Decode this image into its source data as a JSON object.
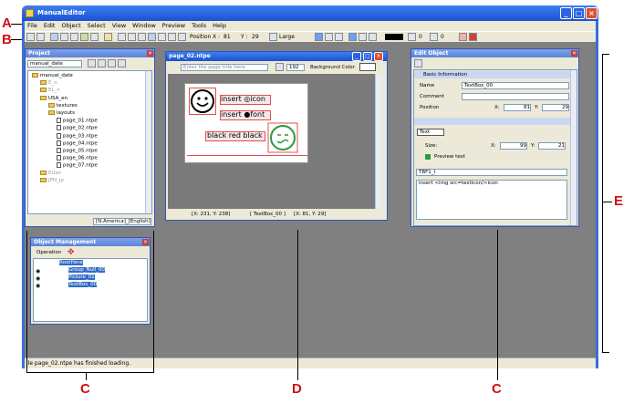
{
  "callouts": {
    "a": "A",
    "b": "B",
    "c": "C",
    "d": "D",
    "e": "E"
  },
  "app": {
    "title": "ManualEditor"
  },
  "menu": [
    "File",
    "Edit",
    "Object",
    "Select",
    "View",
    "Window",
    "Preview",
    "Tools",
    "Help"
  ],
  "toolbar": {
    "position_label": "Position",
    "x_label": "X :",
    "x_value": "81",
    "y_label": "Y :",
    "y_value": "29",
    "font_size": "Large",
    "spacing_a": "0",
    "spacing_b": "0"
  },
  "project": {
    "title": "Project",
    "selector": "manual_date",
    "tree": [
      {
        "label": "manual_date",
        "type": "folder",
        "level": 0
      },
      {
        "label": "E_n",
        "type": "folder",
        "level": 1,
        "faded": true
      },
      {
        "label": "EL_n",
        "type": "folder",
        "level": 1,
        "faded": true
      },
      {
        "label": "USA_en",
        "type": "folder",
        "level": 1
      },
      {
        "label": "textures",
        "type": "folder",
        "level": 2
      },
      {
        "label": "layouts",
        "type": "folder",
        "level": 2
      },
      {
        "label": "page_01.ntpe",
        "type": "file",
        "level": 3
      },
      {
        "label": "page_02.ntpe",
        "type": "file",
        "level": 3
      },
      {
        "label": "page_03.ntpe",
        "type": "file",
        "level": 3
      },
      {
        "label": "page_04.ntpe",
        "type": "file",
        "level": 3
      },
      {
        "label": "page_05.ntpe",
        "type": "file",
        "level": 3
      },
      {
        "label": "page_06.ntpe",
        "type": "file",
        "level": 3
      },
      {
        "label": "page_07.ntpe",
        "type": "file",
        "level": 3
      },
      {
        "label": "EUen",
        "type": "folder",
        "level": 1,
        "faded": true
      },
      {
        "label": "JPN_jp",
        "type": "folder",
        "level": 1,
        "faded": true
      }
    ],
    "region": "[N.America]_[English]"
  },
  "page": {
    "title": "page_02.ntpe",
    "title_placeholder": "Enter the page title here",
    "page_number": "192",
    "bg_label": "Background Color",
    "text1": "insert ◎icon",
    "text2": "insert ●font",
    "text3": "black red black",
    "status_xy": "[X:  231, Y:  238]",
    "status_obj": "[ TextBox_00 ]",
    "status_pos": "[X:   81, Y:   29]"
  },
  "objmgmt": {
    "title": "Object Management",
    "operation": "Operation",
    "tree": [
      "RootPane",
      "Group_Null_00",
      "Picture_01",
      "TextBox_00"
    ]
  },
  "edit": {
    "title": "Edit Object",
    "basic_info": "Basic Information",
    "name_label": "Name",
    "name_value": "TextBox_00",
    "comment_label": "Comment",
    "comment_value": "",
    "position_label": "Position",
    "x_label": "X:",
    "x_value": "81",
    "y_label": "Y:",
    "y_value": "29",
    "text_tab": "Text",
    "size_label": "Size:",
    "size_x_label": "X:",
    "size_x": "99",
    "size_y_label": "Y:",
    "size_y": "21",
    "preview_label": "Preview text",
    "font_select": "TBF1_I",
    "text_content": "insert <img src=texticon/>icon"
  },
  "status": {
    "message": "ile page_02.ntpe has finished loading."
  }
}
